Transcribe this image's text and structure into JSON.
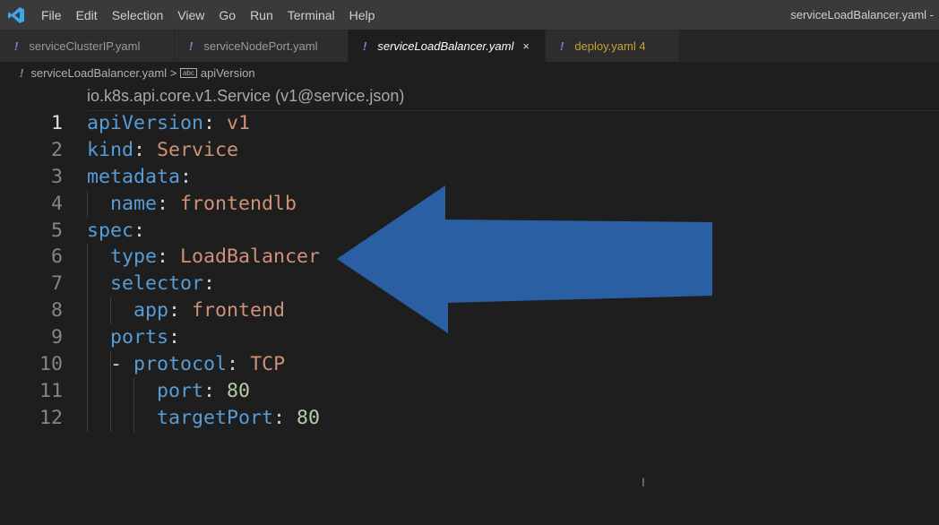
{
  "menu": {
    "items": [
      "File",
      "Edit",
      "Selection",
      "View",
      "Go",
      "Run",
      "Terminal",
      "Help"
    ]
  },
  "window_title": "serviceLoadBalancer.yaml -",
  "tabs": [
    {
      "label": "serviceClusterIP.yaml"
    },
    {
      "label": "serviceNodePort.yaml"
    },
    {
      "label": "serviceLoadBalancer.yaml",
      "active": true,
      "close": "×"
    },
    {
      "label": "deploy.yaml",
      "badge": "4"
    }
  ],
  "breadcrumb": {
    "file": "serviceLoadBalancer.yaml",
    "separator": ">",
    "symbol": "apiVersion"
  },
  "schema_hint": "io.k8s.api.core.v1.Service (v1@service.json)",
  "code": {
    "lines": [
      {
        "n": "1",
        "indent": 0,
        "key": "apiVersion",
        "val": "v1",
        "type": "s"
      },
      {
        "n": "2",
        "indent": 0,
        "key": "kind",
        "val": "Service",
        "type": "s"
      },
      {
        "n": "3",
        "indent": 0,
        "key": "metadata",
        "val": "",
        "type": "s"
      },
      {
        "n": "4",
        "indent": 1,
        "key": "name",
        "val": "frontendlb",
        "type": "s"
      },
      {
        "n": "5",
        "indent": 0,
        "key": "spec",
        "val": "",
        "type": "s"
      },
      {
        "n": "6",
        "indent": 1,
        "key": "type",
        "val": "LoadBalancer",
        "type": "s"
      },
      {
        "n": "7",
        "indent": 1,
        "key": "selector",
        "val": "",
        "type": "s"
      },
      {
        "n": "8",
        "indent": 2,
        "key": "app",
        "val": "frontend",
        "type": "s"
      },
      {
        "n": "9",
        "indent": 1,
        "key": "ports",
        "val": "",
        "type": "s"
      },
      {
        "n": "10",
        "indent": 2,
        "dash": true,
        "key": "protocol",
        "val": "TCP",
        "type": "s"
      },
      {
        "n": "11",
        "indent": 3,
        "key": "port",
        "val": "80",
        "type": "n"
      },
      {
        "n": "12",
        "indent": 3,
        "key": "targetPort",
        "val": "80",
        "type": "n"
      }
    ]
  },
  "annotation": {
    "arrow_color": "#2b5fa3",
    "direction": "left"
  }
}
